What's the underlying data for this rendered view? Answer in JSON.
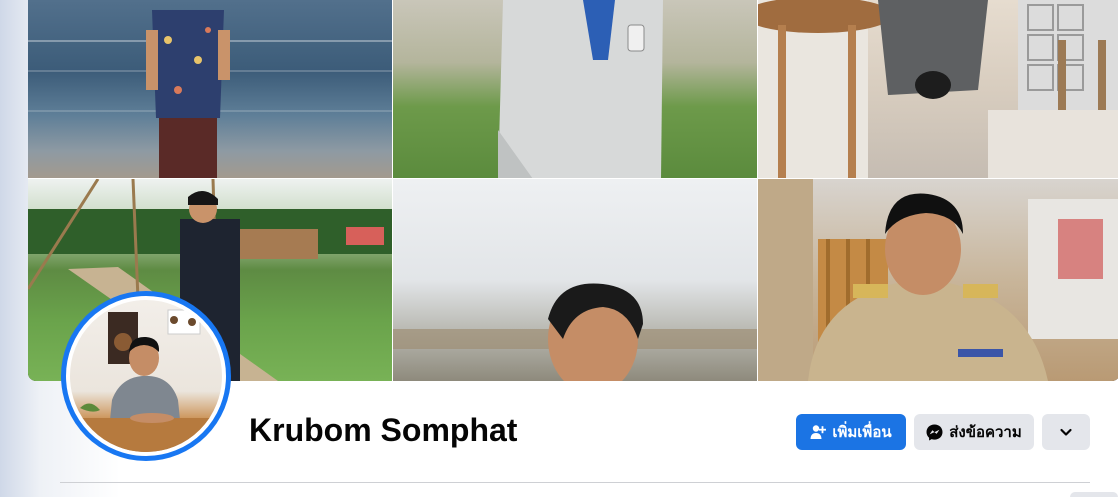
{
  "profile": {
    "name": "Krubom Somphat"
  },
  "actions": {
    "add_friend_label": "เพิ่มเพื่อน",
    "message_label": "ส่งข้อความ",
    "add_friend_icon": "person-add-icon",
    "message_icon": "messenger-icon",
    "more_icon": "chevron-down-icon"
  },
  "colors": {
    "primary": "#1b74e4",
    "secondary_button": "#e4e6eb",
    "avatar_ring": "#1877f2"
  }
}
